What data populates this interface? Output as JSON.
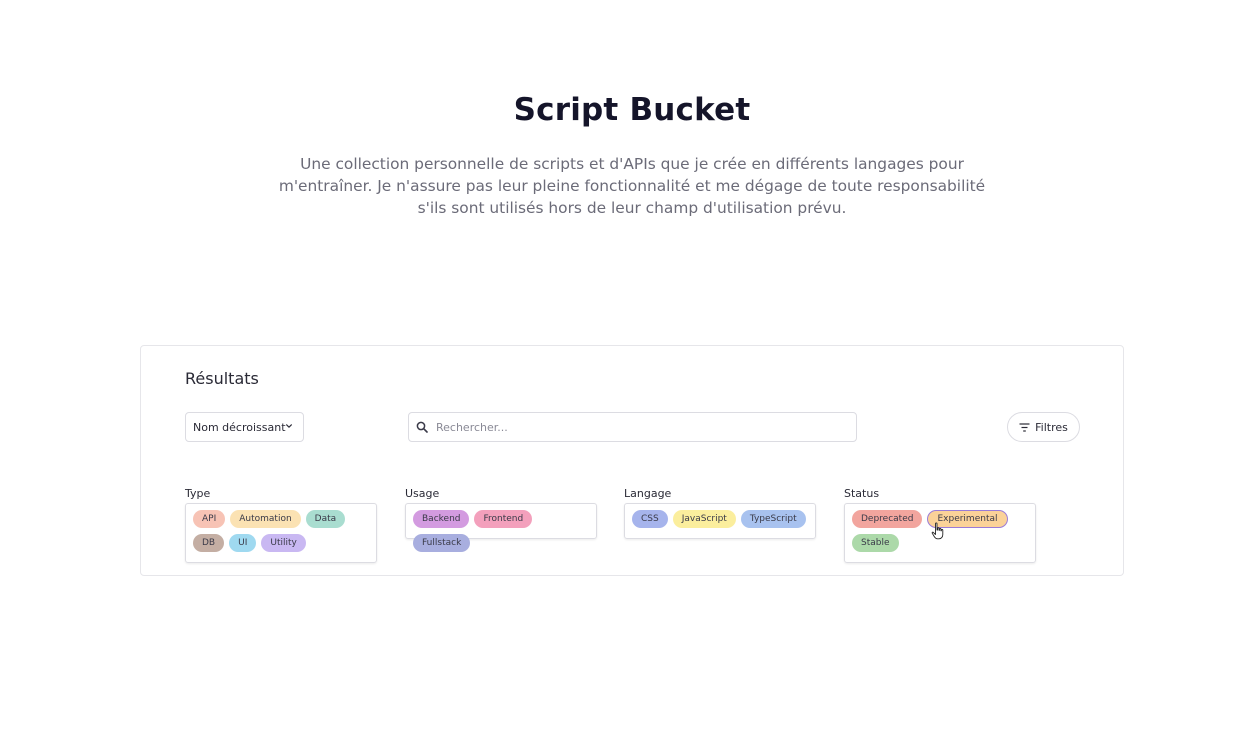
{
  "hero": {
    "title": "Script Bucket",
    "description": "Une collection personnelle de scripts et d'APIs que je crée en différents langages pour m'entraîner. Je n'assure pas leur pleine fonctionnalité et me dégage de toute responsabilité s'ils sont utilisés hors de leur champ d'utilisation prévu."
  },
  "results": {
    "title": "Résultats",
    "sort": {
      "value": "Nom décroissant",
      "icon": "chevron-down-icon"
    },
    "search": {
      "placeholder": "Rechercher...",
      "value": "",
      "icon": "search-icon"
    },
    "filters": {
      "label": "Filtres",
      "icon": "filter-icon"
    },
    "groups": [
      {
        "label": "Type",
        "tags": [
          {
            "label": "API",
            "color": "#f7c3b5"
          },
          {
            "label": "Automation",
            "color": "#fbe2b3"
          },
          {
            "label": "Data",
            "color": "#a9ddd0"
          },
          {
            "label": "DB",
            "color": "#c4aea3"
          },
          {
            "label": "UI",
            "color": "#9fd9f0"
          },
          {
            "label": "Utility",
            "color": "#c9b8f2"
          }
        ]
      },
      {
        "label": "Usage",
        "tags": [
          {
            "label": "Backend",
            "color": "#d39be0"
          },
          {
            "label": "Frontend",
            "color": "#f3a0bc"
          },
          {
            "label": "Fullstack",
            "color": "#a8aedf"
          }
        ]
      },
      {
        "label": "Langage",
        "tags": [
          {
            "label": "CSS",
            "color": "#a6b4ec"
          },
          {
            "label": "JavaScript",
            "color": "#fbee9d"
          },
          {
            "label": "TypeScript",
            "color": "#a8c2ef"
          }
        ]
      },
      {
        "label": "Status",
        "tags": [
          {
            "label": "Deprecated",
            "color": "#f2a59e"
          },
          {
            "label": "Experimental",
            "color": "#fbd298",
            "selected": true
          },
          {
            "label": "Stable",
            "color": "#acd9a9"
          }
        ]
      }
    ]
  }
}
